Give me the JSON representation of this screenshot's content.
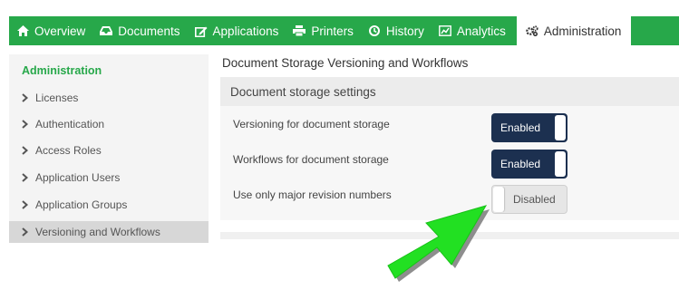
{
  "nav": {
    "tabs": [
      {
        "label": "Overview",
        "icon": "home-icon"
      },
      {
        "label": "Documents",
        "icon": "inbox-icon"
      },
      {
        "label": "Applications",
        "icon": "edit-icon"
      },
      {
        "label": "Printers",
        "icon": "printer-icon"
      },
      {
        "label": "History",
        "icon": "clock-icon"
      },
      {
        "label": "Analytics",
        "icon": "chart-icon"
      },
      {
        "label": "Administration",
        "icon": "cogs-icon",
        "active": true
      }
    ],
    "accent_color": "#27a84a"
  },
  "sidebar": {
    "title": "Administration",
    "items": [
      {
        "label": "Licenses"
      },
      {
        "label": "Authentication"
      },
      {
        "label": "Access Roles"
      },
      {
        "label": "Application Users"
      },
      {
        "label": "Application Groups"
      },
      {
        "label": "Versioning and Workflows",
        "active": true
      }
    ]
  },
  "main": {
    "title": "Document Storage Versioning and Workflows",
    "panel_heading": "Document storage settings",
    "settings": [
      {
        "label": "Versioning for document storage",
        "state": "Enabled"
      },
      {
        "label": "Workflows for document storage",
        "state": "Enabled"
      },
      {
        "label": "Use only major revision numbers",
        "state": "Disabled"
      }
    ]
  },
  "annotation": {
    "arrow_color": "#22e022",
    "icon": "pointer-arrow-icon"
  }
}
